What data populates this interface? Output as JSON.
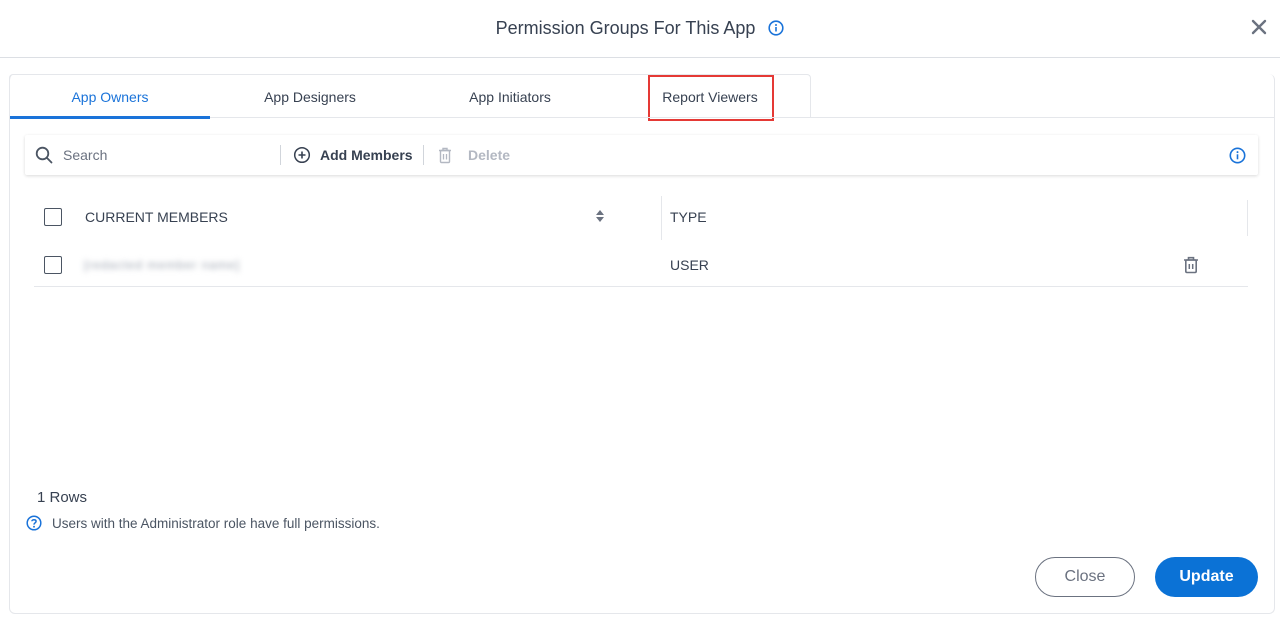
{
  "dialog": {
    "title": "Permission Groups For This App",
    "close_icon": "close-icon",
    "info_icon": "info-icon"
  },
  "tabs": [
    {
      "label": "App Owners",
      "active": true
    },
    {
      "label": "App Designers",
      "active": false
    },
    {
      "label": "App Initiators",
      "active": false
    },
    {
      "label": "Report Viewers",
      "active": false,
      "highlighted": true
    }
  ],
  "toolbar": {
    "search_placeholder": "Search",
    "search_value": "",
    "add_label": "Add Members",
    "delete_label": "Delete"
  },
  "table": {
    "columns": [
      "CURRENT MEMBERS",
      "TYPE"
    ],
    "rows": [
      {
        "member": "[redacted member name]",
        "type": "USER"
      }
    ]
  },
  "footer": {
    "rows_count": "1 Rows",
    "help_text": "Users with the Administrator role have full permissions.",
    "close_label": "Close",
    "update_label": "Update"
  },
  "colors": {
    "accent": "#1a73d9",
    "primary_button": "#0b72d6",
    "highlight_box": "#e53935"
  }
}
